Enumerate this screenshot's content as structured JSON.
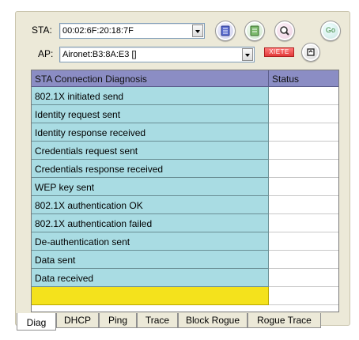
{
  "sta": {
    "label": "STA:",
    "value": "00:02:6F:20:18:7F"
  },
  "ap": {
    "label": "AP:",
    "value": "Aironet:B3:8A:E3 []",
    "tag_label": "XIETE"
  },
  "toolbar": {
    "buttons": [
      {
        "icon": "list-icon"
      },
      {
        "icon": "document-icon"
      },
      {
        "icon": "magnifier-icon"
      },
      {
        "icon": "go-icon",
        "label": "Go"
      }
    ],
    "refresh_icon": "refresh-icon"
  },
  "table": {
    "headers": [
      "STA Connection Diagnosis",
      "Status"
    ],
    "rows": [
      {
        "name": "802.1X initiated send",
        "status": ""
      },
      {
        "name": "Identity request sent",
        "status": ""
      },
      {
        "name": "Identity response received",
        "status": ""
      },
      {
        "name": "Credentials request sent",
        "status": ""
      },
      {
        "name": "Credentials response received",
        "status": ""
      },
      {
        "name": "WEP key sent",
        "status": ""
      },
      {
        "name": "802.1X authentication OK",
        "status": ""
      },
      {
        "name": "802.1X authentication failed",
        "status": ""
      },
      {
        "name": "De-authentication sent",
        "status": ""
      },
      {
        "name": "Data sent",
        "status": ""
      },
      {
        "name": "Data received",
        "status": ""
      },
      {
        "name": "",
        "status": ""
      }
    ]
  },
  "tabs": [
    "Diag",
    "DHCP",
    "Ping",
    "Trace",
    "Block Rogue",
    "Rogue Trace"
  ],
  "active_tab": "Diag",
  "colors": {
    "panel": "#ece9d8",
    "header": "#8b8dc4",
    "row": "#a9dce3",
    "highlight_row": "#f4e21c",
    "tag": "#e23a3a"
  }
}
